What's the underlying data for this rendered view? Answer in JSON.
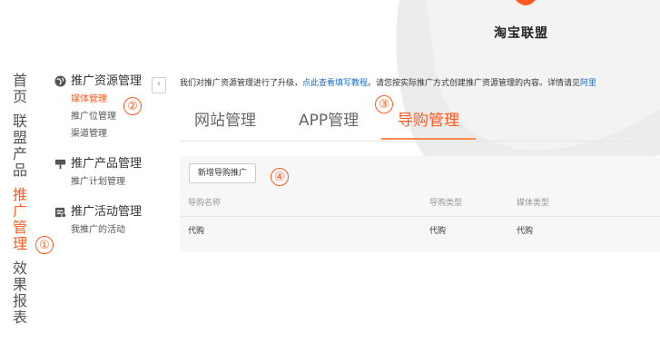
{
  "brand": {
    "name": "淘宝联盟",
    "accent": "#ff5a1f"
  },
  "main_nav": [
    {
      "label": "首页",
      "active": false
    },
    {
      "label": "联盟产品",
      "active": false
    },
    {
      "label": "推广管理",
      "active": true
    },
    {
      "label": "效果报表",
      "active": false
    }
  ],
  "sidebar": {
    "collapse_icon": "‹",
    "groups": [
      {
        "title": "推广资源管理",
        "icon": "globe-icon",
        "items": [
          {
            "label": "媒体管理",
            "active": true
          },
          {
            "label": "推广位管理",
            "active": false
          },
          {
            "label": "渠道管理",
            "active": false
          }
        ]
      },
      {
        "title": "推广产品管理",
        "icon": "flag-icon",
        "items": [
          {
            "label": "推广计划管理",
            "active": false
          }
        ]
      },
      {
        "title": "推广活动管理",
        "icon": "calendar-icon",
        "items": [
          {
            "label": "我推广的活动",
            "active": false
          }
        ]
      }
    ]
  },
  "annotations": [
    "①",
    "②",
    "③",
    "④"
  ],
  "notice": {
    "prefix": "我们对推广资源管理进行了升级，",
    "link": "点此查看填写教程",
    "suffix": "。请您按实际推广方式创建推广资源管理的内容。详情请见",
    "link2": "阿里"
  },
  "tabs": [
    {
      "label": "网站管理",
      "active": false
    },
    {
      "label": "APP管理",
      "active": false
    },
    {
      "label": "导购管理",
      "active": true
    }
  ],
  "content": {
    "add_button": "新增导购推广",
    "columns": [
      "导购名称",
      "导购类型",
      "媒体类型"
    ],
    "rows": [
      [
        "代购",
        "代购",
        "代购"
      ]
    ]
  }
}
